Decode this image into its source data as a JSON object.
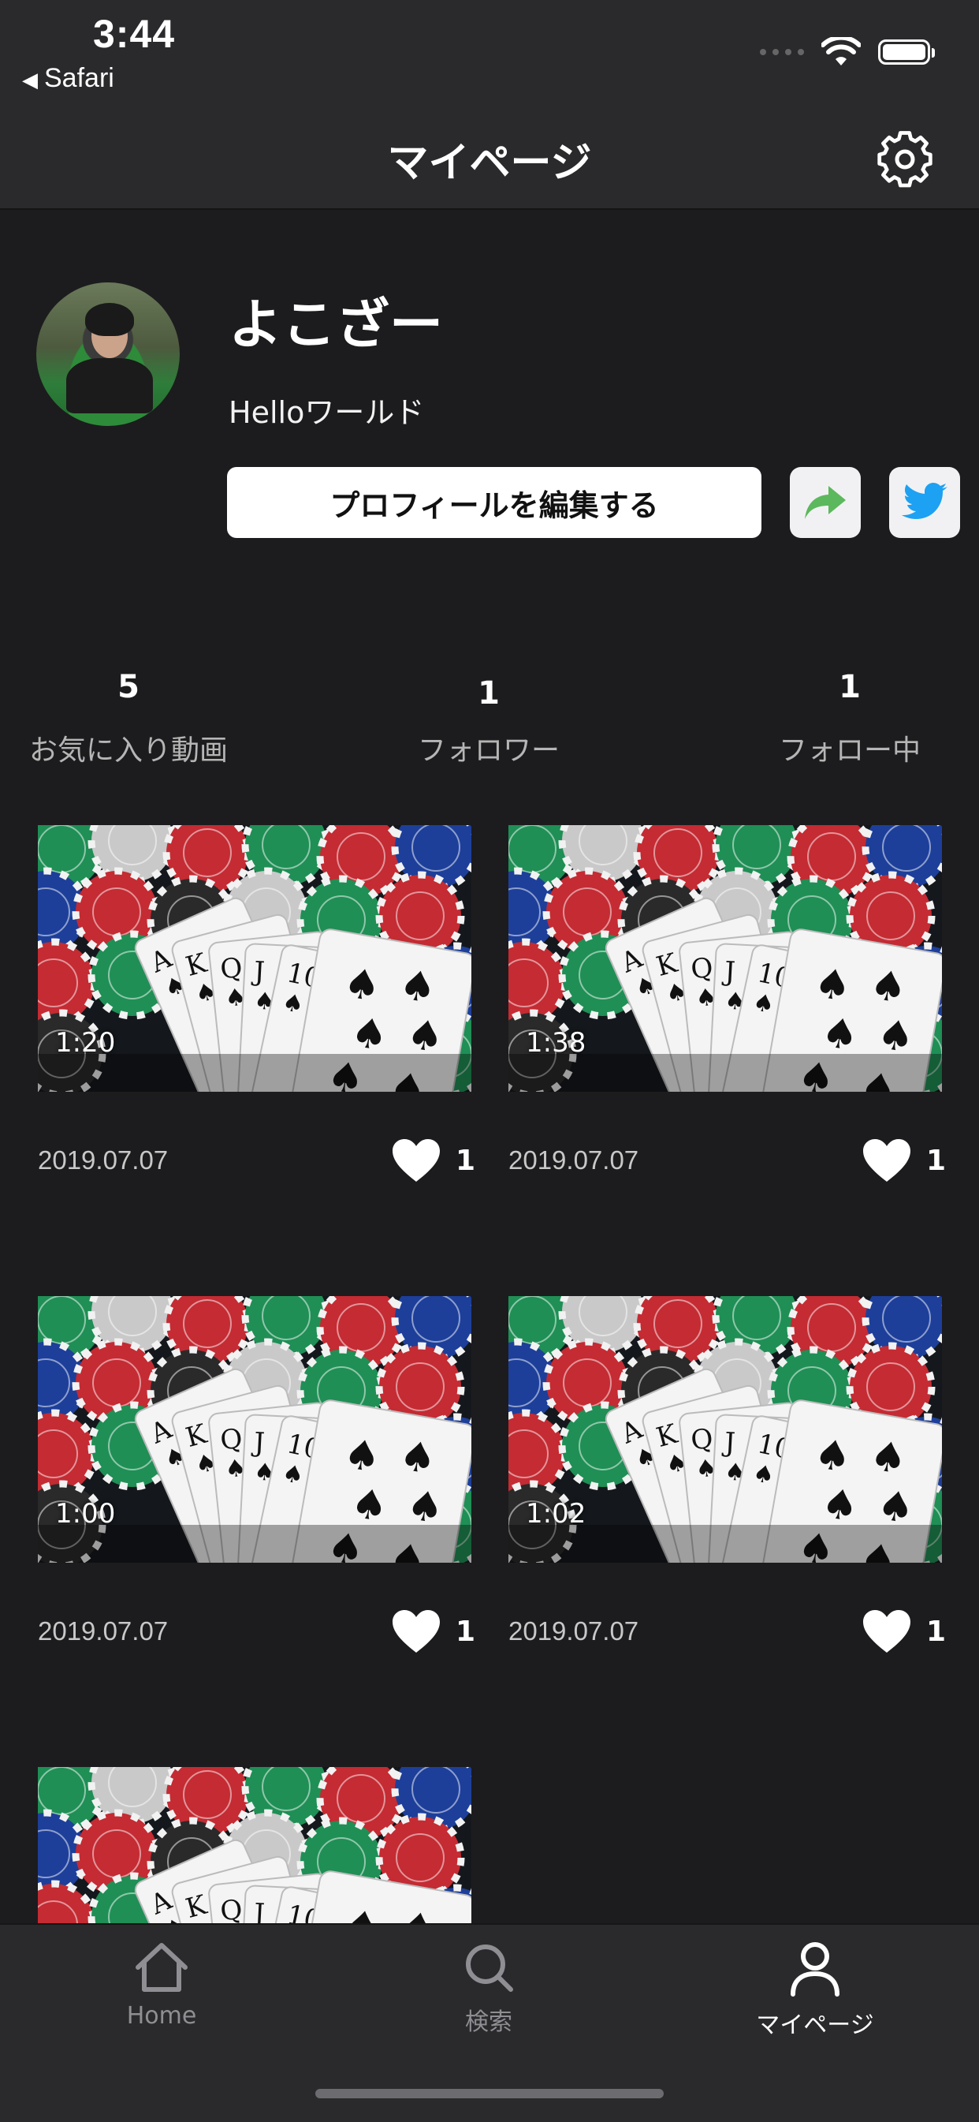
{
  "status_bar": {
    "time": "3:44",
    "back_app": "Safari"
  },
  "nav": {
    "title": "マイページ"
  },
  "profile": {
    "username": "よこざー",
    "bio": "Helloワールド",
    "edit_button": "プロフィールを編集する"
  },
  "stats": {
    "favorites": {
      "count": "5",
      "label": "お気に入り動画"
    },
    "followers": {
      "count": "1",
      "label": "フォロワー"
    },
    "following": {
      "count": "1",
      "label": "フォロー中"
    }
  },
  "videos": [
    {
      "duration": "1:20",
      "date": "2019.07.07",
      "likes": "1"
    },
    {
      "duration": "1:38",
      "date": "2019.07.07",
      "likes": "1"
    },
    {
      "duration": "1:00",
      "date": "2019.07.07",
      "likes": "1"
    },
    {
      "duration": "1:02",
      "date": "2019.07.07",
      "likes": "1"
    },
    {
      "duration": "",
      "date": "",
      "likes": ""
    }
  ],
  "tabs": [
    {
      "label": "Home",
      "icon": "home-icon",
      "active": false
    },
    {
      "label": "検索",
      "icon": "search-icon",
      "active": false
    },
    {
      "label": "マイページ",
      "icon": "person-icon",
      "active": true
    }
  ],
  "colors": {
    "background": "#1c1c1e",
    "bar": "#2a2a2c",
    "share_green": "#5cb85c",
    "twitter_blue": "#1da1f2"
  }
}
